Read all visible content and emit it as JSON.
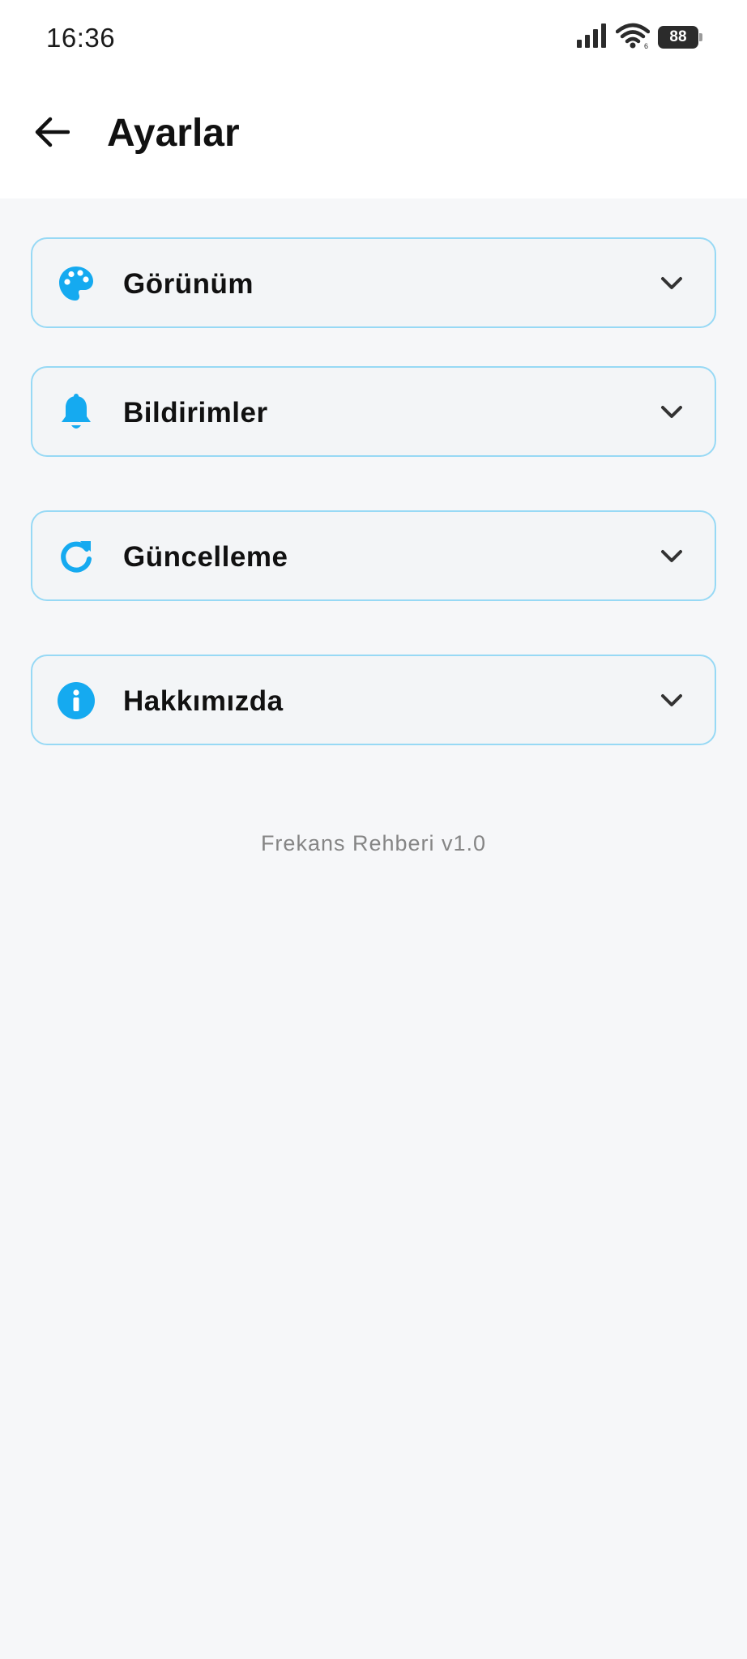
{
  "status_bar": {
    "time": "16:36",
    "battery": "88",
    "icons": [
      "signal-icon",
      "wifi-icon",
      "battery-icon"
    ]
  },
  "app_bar": {
    "back_icon": "arrow-left-icon",
    "title": "Ayarlar"
  },
  "sections": [
    {
      "label": "Görünüm",
      "icon": "palette-icon"
    },
    {
      "label": "Bildirimler",
      "icon": "bell-icon"
    },
    {
      "label": "Güncelleme",
      "icon": "refresh-icon"
    },
    {
      "label": "Hakkımızda",
      "icon": "info-icon"
    }
  ],
  "footer": {
    "version": "Frekans Rehberi v1.0"
  },
  "colors": {
    "accent": "#15aaf0",
    "card_border": "#97d9f5",
    "background": "#f6f7f9"
  }
}
